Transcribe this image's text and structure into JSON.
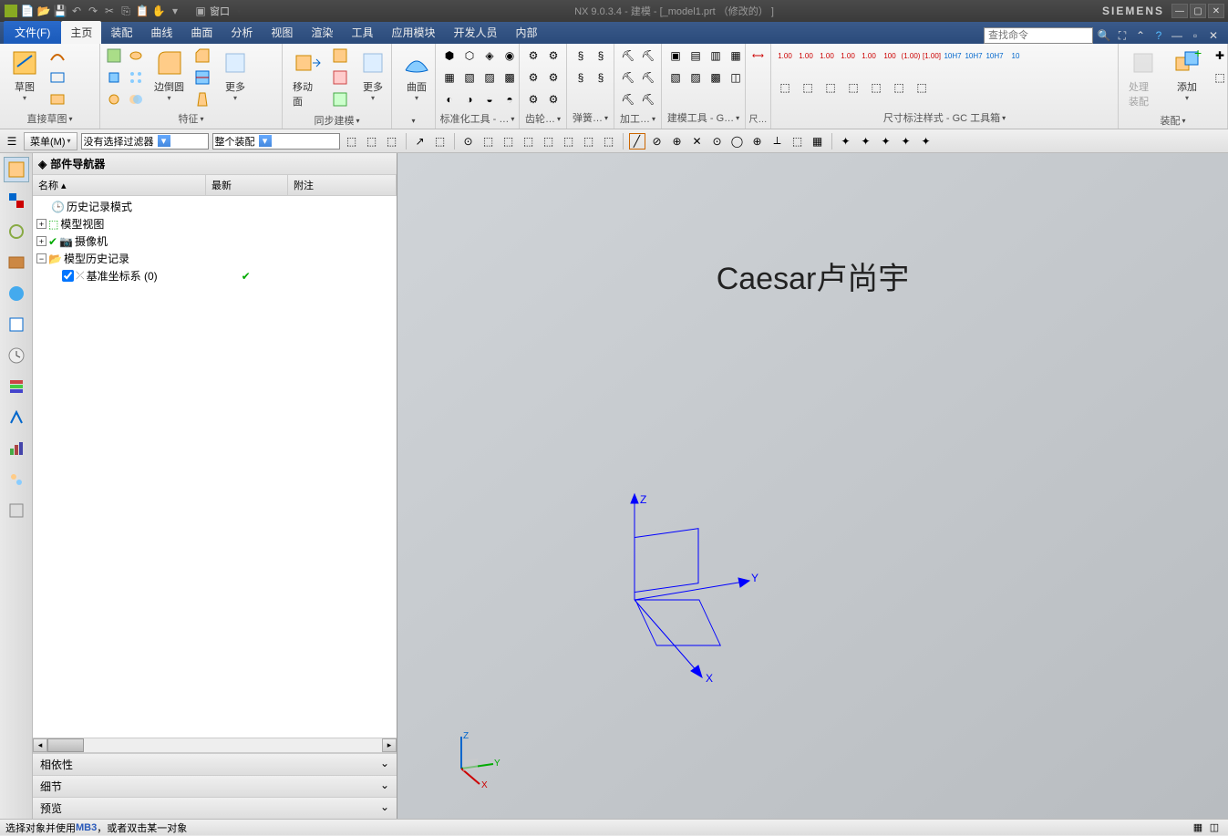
{
  "titlebar": {
    "window_menu": "窗口",
    "title": "NX 9.0.3.4 - 建模 - [_model1.prt （修改的） ]",
    "brand": "SIEMENS"
  },
  "tabs": {
    "file": "文件(F)",
    "items": [
      "主页",
      "装配",
      "曲线",
      "曲面",
      "分析",
      "视图",
      "渲染",
      "工具",
      "应用模块",
      "开发人员",
      "内部"
    ],
    "search_placeholder": "查找命令"
  },
  "ribbon": {
    "sketch_big": "草图",
    "sketch_group": "直接草图",
    "edgefillet": "边倒圆",
    "more1": "更多",
    "feature_group": "特征",
    "movefacet": "移动面",
    "more2": "更多",
    "sync_group": "同步建模",
    "curve": "曲面",
    "std_group": "标准化工具 - …",
    "gear_group": "齿轮…",
    "spring_group": "弹簧…",
    "mfg_group": "加工…",
    "model_group": "建模工具 - G…",
    "annot_group": "尺寸标注样式 - GC 工具箱",
    "measure_group": "尺…",
    "assy_process": "处理装配",
    "assy_add": "添加",
    "assy_group": "装配"
  },
  "toolbar2": {
    "menu_btn": "菜单(M)",
    "filter_combo": "没有选择过滤器",
    "scope_combo": "整个装配"
  },
  "navigator": {
    "title": "部件导航器",
    "col_name": "名称",
    "col_latest": "最新",
    "col_note": "附注",
    "history_mode": "历史记录模式",
    "model_views": "模型视图",
    "cameras": "摄像机",
    "model_history": "模型历史记录",
    "datum_csys": "基准坐标系 (0)",
    "section_dep": "相依性",
    "section_detail": "细节",
    "section_preview": "预览"
  },
  "viewport": {
    "watermark": "Caesar卢尚宇",
    "axis_x": "X",
    "axis_y": "Y",
    "axis_z": "Z",
    "triad_x": "X",
    "triad_y": "Y",
    "triad_z": "Z"
  },
  "statusbar": {
    "prefix": "选择对象并使用 ",
    "key": "MB3",
    "suffix": "，或者双击某一对象"
  }
}
